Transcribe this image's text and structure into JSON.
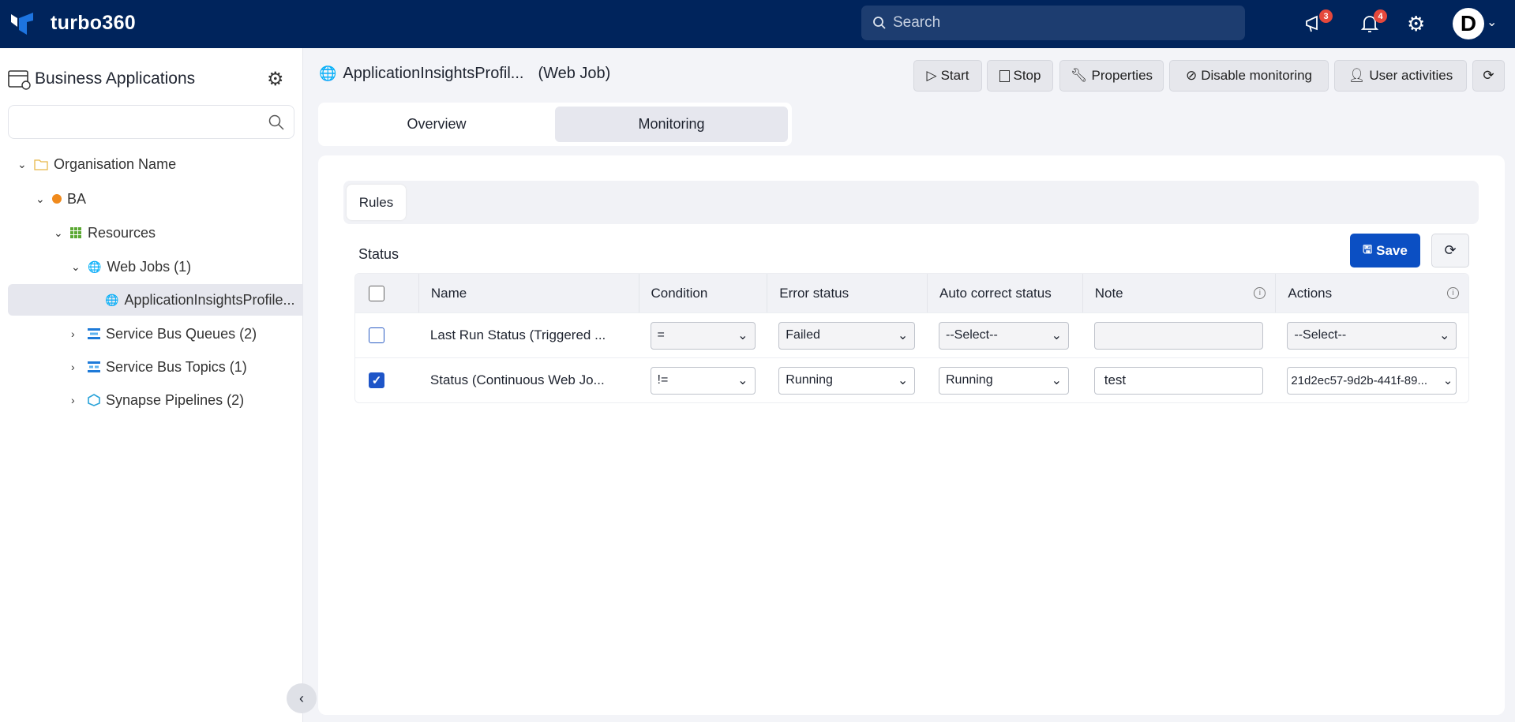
{
  "header": {
    "brand": "turbo360",
    "search_placeholder": "Search",
    "announcements_count": "3",
    "notifications_count": "4",
    "avatar_initial": "D",
    "colors": {
      "topbar": "#00245c",
      "accent": "#0b4fc3",
      "badge": "#e5483c"
    }
  },
  "sidebar": {
    "title": "Business Applications",
    "search_placeholder": "",
    "tree": [
      {
        "label": "Organisation Name",
        "icon": "folder-icon",
        "expanded": true
      },
      {
        "label": "BA",
        "icon": "orange-dot-icon",
        "expanded": true
      },
      {
        "label": "Resources",
        "icon": "grid-icon",
        "expanded": true
      },
      {
        "label": "Web Jobs (1)",
        "icon": "webjob-icon",
        "expanded": true
      },
      {
        "label": "ApplicationInsightsProfile...",
        "icon": "webjob-icon",
        "selected": true
      },
      {
        "label": "Service Bus Queues (2)",
        "icon": "queue-icon",
        "expanded": false
      },
      {
        "label": "Service Bus Topics (1)",
        "icon": "topic-icon",
        "expanded": false
      },
      {
        "label": "Synapse Pipelines (2)",
        "icon": "synapse-icon",
        "expanded": false
      }
    ]
  },
  "page": {
    "title": "ApplicationInsightsProfil...",
    "type": "(Web Job)",
    "toolbar": {
      "start": "Start",
      "stop": "Stop",
      "properties": "Properties",
      "disable_monitoring": "Disable monitoring",
      "user_activities": "User activities"
    },
    "tabs": [
      "Overview",
      "Monitoring"
    ],
    "active_tab": "Monitoring",
    "subtab": "Rules",
    "section": "Status",
    "save": "Save"
  },
  "table": {
    "columns": [
      "Name",
      "Condition",
      "Error status",
      "Auto correct status",
      "Note",
      "Actions"
    ],
    "rows": [
      {
        "checked": false,
        "name": "Last Run Status (Triggered ...",
        "condition": "=",
        "error_status": "Failed",
        "auto_correct": "--Select--",
        "note": "",
        "actions": "--Select--"
      },
      {
        "checked": true,
        "name": "Status (Continuous Web Jo...",
        "condition": "!=",
        "error_status": "Running",
        "auto_correct": "Running",
        "note": "test",
        "actions": "21d2ec57-9d2b-441f-89..."
      }
    ]
  }
}
